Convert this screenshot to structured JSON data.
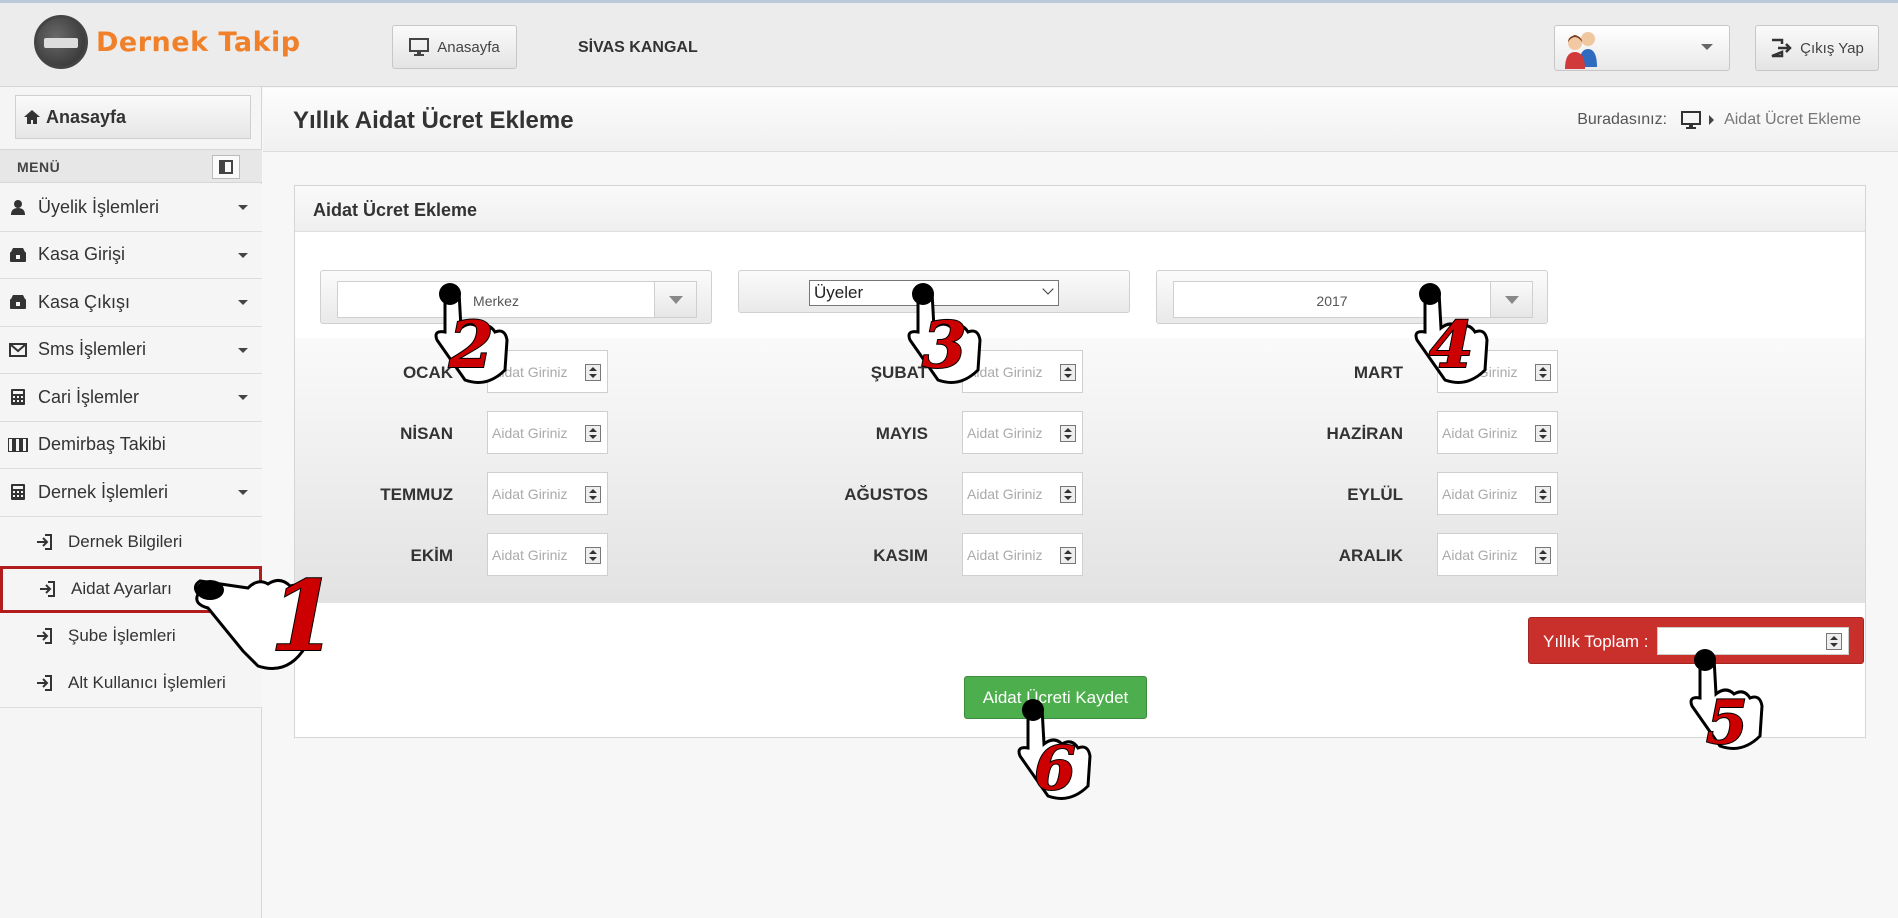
{
  "brand": {
    "name": "Dernek Takip"
  },
  "topbar": {
    "home_label": "Anasayfa",
    "org_name": "SİVAS KANGAL",
    "logout_label": "Çıkış Yap"
  },
  "sidebar": {
    "home_label": "Anasayfa",
    "menu_label": "MENÜ",
    "items": [
      {
        "label": "Üyelik İşlemleri",
        "icon": "user-icon"
      },
      {
        "label": "Kasa Girişi",
        "icon": "cash-in-icon"
      },
      {
        "label": "Kasa Çıkışı",
        "icon": "cash-out-icon"
      },
      {
        "label": "Sms İşlemleri",
        "icon": "envelope-icon"
      },
      {
        "label": "Cari İşlemler",
        "icon": "calculator-icon"
      },
      {
        "label": "Demirbaş Takibi",
        "icon": "inventory-icon"
      },
      {
        "label": "Dernek İşlemleri",
        "icon": "calculator-icon"
      }
    ],
    "subitems": [
      {
        "label": "Dernek Bilgileri"
      },
      {
        "label": "Aidat Ayarları"
      },
      {
        "label": "Şube İşlemleri"
      },
      {
        "label": "Alt Kullanıcı İşlemleri"
      }
    ]
  },
  "page": {
    "title": "Yıllık Aidat Ücret Ekleme",
    "breadcrumb_prefix": "Buradasınız:",
    "breadcrumb_current": "Aidat Ücret Ekleme"
  },
  "panel": {
    "title": "Aidat Ücret Ekleme",
    "branch_value": "Merkez",
    "members_value": "Üyeler",
    "year_value": "2017",
    "input_placeholder": "Aidat Giriniz",
    "months": [
      [
        "OCAK",
        "ŞUBAT",
        "MART"
      ],
      [
        "NİSAN",
        "MAYIS",
        "HAZİRAN"
      ],
      [
        "TEMMUZ",
        "AĞUSTOS",
        "EYLÜL"
      ],
      [
        "EKİM",
        "KASIM",
        "ARALIK"
      ]
    ],
    "total_label": "Yıllık Toplam :",
    "save_label": "Aidat Ücreti Kaydet"
  },
  "callouts": [
    "1",
    "2",
    "3",
    "4",
    "5",
    "6"
  ],
  "colors": {
    "brand_orange": "#f0812a",
    "danger": "#c9302c",
    "success": "#4cae4c",
    "callout": "#cc0000"
  }
}
